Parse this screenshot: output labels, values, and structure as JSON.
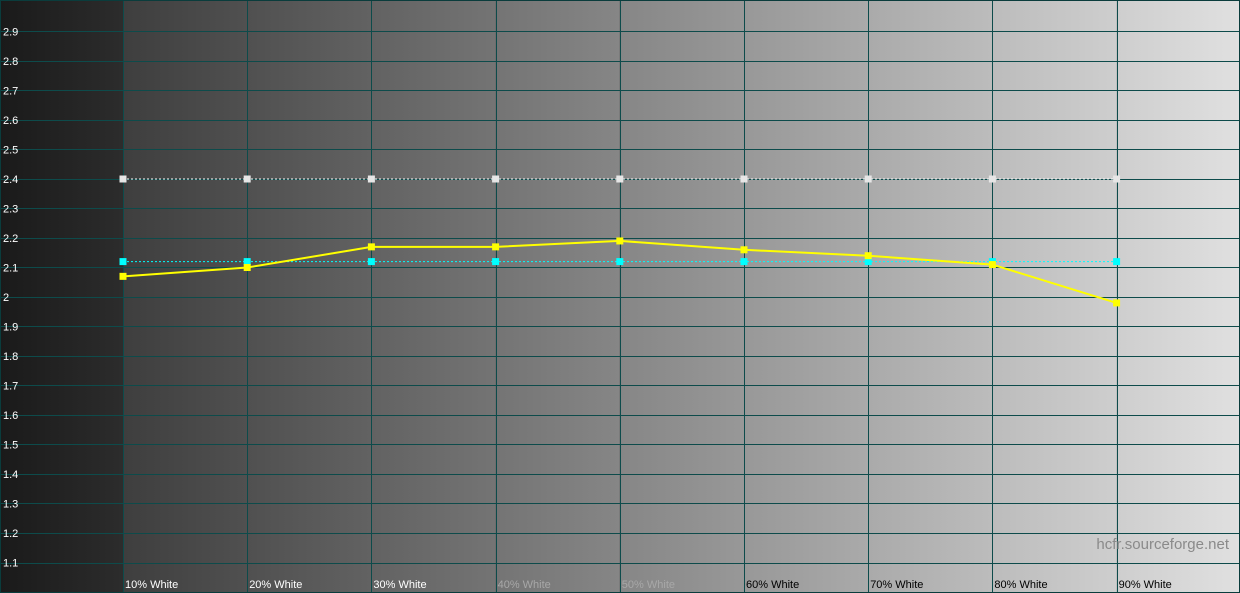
{
  "watermark": "hcfr.sourceforge.net",
  "chart_data": {
    "type": "line",
    "title": "",
    "xlabel": "",
    "ylabel": "",
    "categories": [
      "10% White",
      "20% White",
      "30% White",
      "40% White",
      "50% White",
      "60% White",
      "70% White",
      "80% White",
      "90% White"
    ],
    "ylim": [
      1.0,
      3.0
    ],
    "yticks": [
      1.1,
      1.2,
      1.3,
      1.4,
      1.5,
      1.6,
      1.7,
      1.8,
      1.9,
      2,
      2.1,
      2.2,
      2.3,
      2.4,
      2.5,
      2.6,
      2.7,
      2.8,
      2.9
    ],
    "grid": true,
    "background": "vertical grayscale steps from black to white",
    "series": [
      {
        "color": "#ffffff",
        "style": "dotted",
        "values": [
          2.4,
          2.4,
          2.4,
          2.4,
          2.4,
          2.4,
          2.4,
          2.4,
          2.4
        ]
      },
      {
        "color": "#00ffff",
        "style": "dotted",
        "values": [
          2.12,
          2.12,
          2.12,
          2.12,
          2.12,
          2.12,
          2.12,
          2.12,
          2.12
        ]
      },
      {
        "color": "#ffff00",
        "style": "solid",
        "values": [
          2.07,
          2.1,
          2.17,
          2.17,
          2.19,
          2.16,
          2.14,
          2.11,
          1.98
        ]
      }
    ],
    "colors": {
      "grid": "#0d4b4b",
      "label_light": "#ffffff",
      "label_dark": "#000000"
    }
  }
}
